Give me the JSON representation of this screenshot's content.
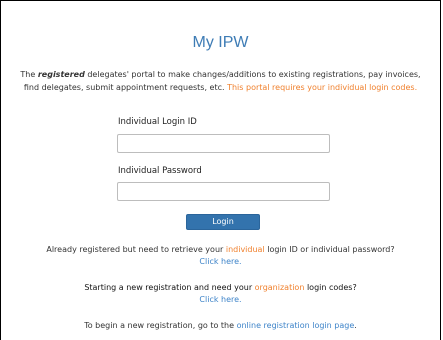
{
  "page": {
    "title": "My IPW",
    "intro": {
      "part1": "The ",
      "emphasis": "registered",
      "part2": " delegates' portal to make changes/additions to existing registrations, pay invoices, find delegates, submit appointment requests, etc. ",
      "highlight": "This portal requires your individual login codes."
    },
    "login_id_label": "Individual Login ID",
    "login_id_value": "",
    "password_label": "Individual Password",
    "password_value": "",
    "login_button": "Login",
    "retrieve": {
      "part1": "Already registered but need to retrieve your ",
      "highlight": "individual",
      "part2": " login ID or individual password? ",
      "link": "Click here."
    },
    "new_reg": {
      "part1": "Starting a new registration and need your ",
      "highlight": "organization",
      "part2": " login codes?",
      "link": "Click here."
    },
    "begin": {
      "part1": "To begin a new registration, go to the ",
      "link": "online registration login page",
      "part2": "."
    }
  },
  "colors": {
    "title": "#3e7cb5",
    "accent_orange": "#f0812e",
    "button": "#3373ad",
    "link": "#3e84c9"
  }
}
